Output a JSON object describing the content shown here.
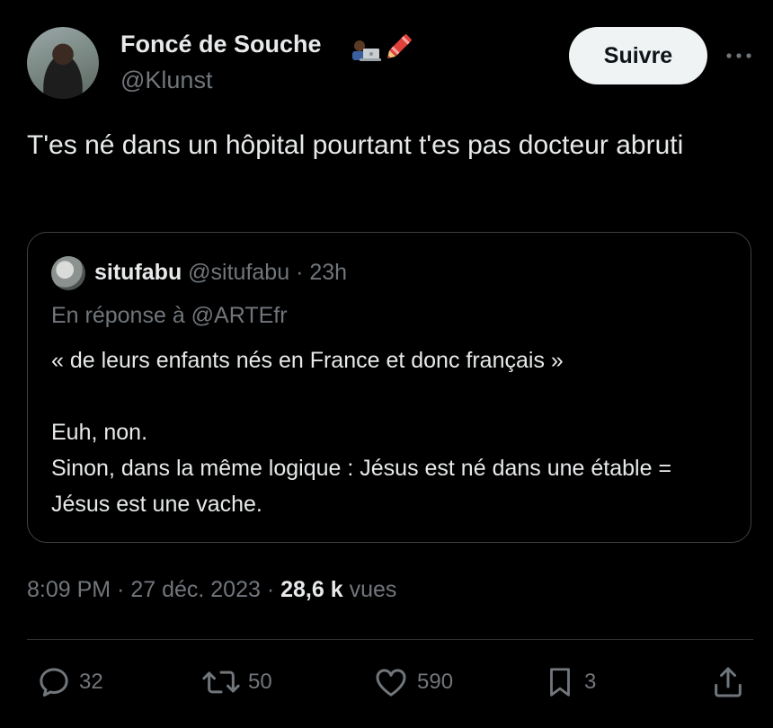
{
  "author": {
    "name": "Foncé de Souche",
    "handle": "@Klunst",
    "emoji_icons": [
      "technologist-laptop-icon",
      "crayon-pencil-icon"
    ]
  },
  "header": {
    "follow_label": "Suivre",
    "more_icon": "more-horizontal-icon"
  },
  "tweet": {
    "text": "T'es né dans un hôpital pourtant t'es pas docteur abruti"
  },
  "quote": {
    "name": "situfabu",
    "handle": "@situfabu",
    "separator": " · ",
    "time": "23h",
    "reply_to": "En réponse à @ARTEfr",
    "line1": "« de leurs enfants nés en France et donc français »",
    "line2": "Euh, non.",
    "line3": "Sinon, dans la même logique : Jésus est né dans une étable = Jésus est une vache."
  },
  "meta": {
    "time": "8:09 PM",
    "sep": " · ",
    "date": "27 déc. 2023",
    "views_count": "28,6 k",
    "views_label": " vues"
  },
  "actions": {
    "replies": "32",
    "retweets": "50",
    "likes": "590",
    "bookmarks": "3"
  },
  "colors": {
    "background": "#000000",
    "text": "#e7e9ea",
    "secondary": "#71767b",
    "border": "#3e4144",
    "button_bg": "#eff3f4"
  }
}
